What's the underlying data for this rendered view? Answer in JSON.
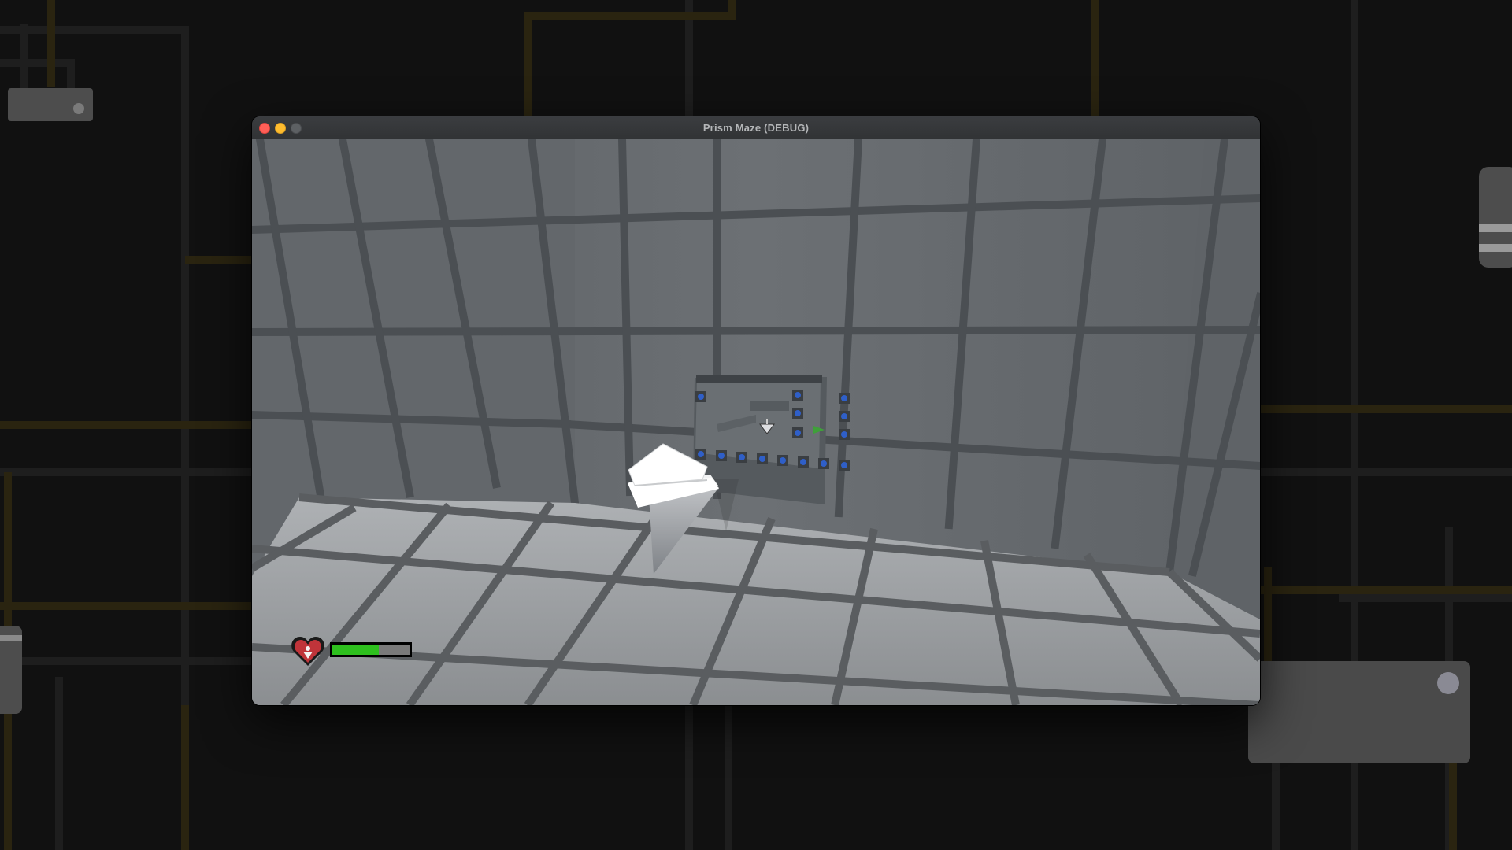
{
  "window": {
    "title": "Prism Maze (DEBUG)"
  },
  "hud": {
    "health_fraction": 0.6,
    "health_color": "#2ec01e",
    "heart_icon": "heart-icon",
    "heart_color": "#c0343a"
  },
  "scene": {
    "player": "white-prism-crystal",
    "wall_panel_orb_color": "#2f5fc8",
    "panel_arrow_color": "#3fa03a"
  }
}
